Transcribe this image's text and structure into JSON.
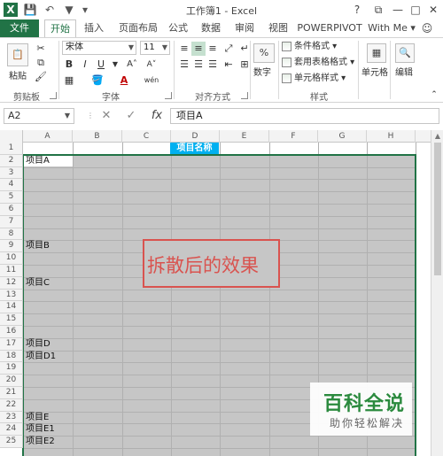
{
  "window": {
    "title": "工作簿1 - Excel",
    "help": "?",
    "restore": "⧉",
    "minimize": "—",
    "maximize": "□",
    "close": "✕"
  },
  "qat": {
    "save": "💾",
    "undo": "↶",
    "redo": "↷",
    "filter": "▼",
    "more": "▾"
  },
  "tabs": [
    "文件",
    "开始",
    "插入",
    "页面布局",
    "公式",
    "数据",
    "审阅",
    "视图",
    "POWERPIVOT",
    "With Me ▾"
  ],
  "ribbon": {
    "clipboard": {
      "paste": "粘贴",
      "label": "剪贴板"
    },
    "font": {
      "name": "宋体",
      "size": "11",
      "bold": "B",
      "italic": "I",
      "underline": "U",
      "grow": "A˄",
      "shrink": "A˅",
      "label": "字体",
      "font_color": "A",
      "phonetic": "wén"
    },
    "alignment": {
      "label": "对齐方式"
    },
    "number": {
      "label": "数字",
      "icon": "%"
    },
    "styles": {
      "conditional": "条件格式 ▾",
      "table": "套用表格格式 ▾",
      "cell": "单元格样式 ▾",
      "label": "样式"
    },
    "cells": {
      "label": "单元格"
    },
    "editing": {
      "label": "编辑"
    }
  },
  "formula_bar": {
    "name_box": "A2",
    "cancel": "✕",
    "enter": "✓",
    "fx": "fx",
    "content": "项目A"
  },
  "columns": [
    "A",
    "B",
    "C",
    "D",
    "E",
    "F",
    "G",
    "H"
  ],
  "rows": [
    "1",
    "2",
    "3",
    "4",
    "5",
    "6",
    "7",
    "8",
    "9",
    "10",
    "11",
    "12",
    "13",
    "14",
    "15",
    "16",
    "17",
    "18",
    "19",
    "20",
    "21",
    "22",
    "23",
    "24",
    "25"
  ],
  "cells": {
    "header_merged": "项目名称",
    "a2": "项目A",
    "a9": "项目B",
    "a12": "项目C",
    "a17": "项目D",
    "a18": "项目D1",
    "a23": "项目E",
    "a24": "项目E1",
    "a25": "项目E2"
  },
  "annotation": "拆散后的效果",
  "watermark": {
    "title": "百科全说",
    "subtitle": "助你轻松解决"
  },
  "colors": {
    "accent": "#217346",
    "header_fill": "#00b0f0",
    "annotation": "#d9534f",
    "watermark": "#2b8a3e"
  }
}
